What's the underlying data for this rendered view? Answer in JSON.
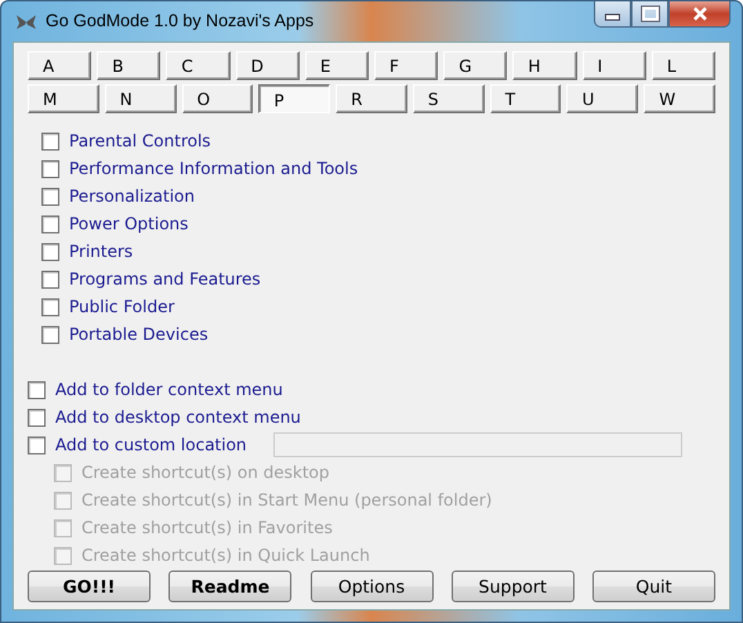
{
  "window": {
    "title": "Go GodMode 1.0 by Nozavi's Apps"
  },
  "letter_tabs": [
    [
      {
        "label": "A",
        "selected": false
      },
      {
        "label": "B",
        "selected": false
      },
      {
        "label": "C",
        "selected": false
      },
      {
        "label": "D",
        "selected": false
      },
      {
        "label": "E",
        "selected": false
      },
      {
        "label": "F",
        "selected": false
      },
      {
        "label": "G",
        "selected": false
      },
      {
        "label": "H",
        "selected": false
      },
      {
        "label": "I",
        "selected": false
      },
      {
        "label": "L",
        "selected": false
      }
    ],
    [
      {
        "label": "M",
        "selected": false
      },
      {
        "label": "N",
        "selected": false
      },
      {
        "label": "O",
        "selected": false
      },
      {
        "label": "P",
        "selected": true
      },
      {
        "label": "R",
        "selected": false
      },
      {
        "label": "S",
        "selected": false
      },
      {
        "label": "T",
        "selected": false
      },
      {
        "label": "U",
        "selected": false
      },
      {
        "label": "W",
        "selected": false
      }
    ]
  ],
  "items": [
    {
      "label": "Parental Controls",
      "checked": false
    },
    {
      "label": "Performance Information and Tools",
      "checked": false
    },
    {
      "label": "Personalization",
      "checked": false
    },
    {
      "label": "Power Options",
      "checked": false
    },
    {
      "label": "Printers",
      "checked": false
    },
    {
      "label": "Programs and Features",
      "checked": false
    },
    {
      "label": "Public Folder",
      "checked": false
    },
    {
      "label": "Portable Devices",
      "checked": false
    }
  ],
  "locations": [
    {
      "label": "Add to folder context menu",
      "checked": false,
      "has_field": false
    },
    {
      "label": "Add to desktop context menu",
      "checked": false,
      "has_field": false
    },
    {
      "label": "Add to custom location",
      "checked": false,
      "has_field": true
    }
  ],
  "shortcuts": [
    {
      "label": "Create shortcut(s) on desktop",
      "checked": false,
      "disabled": true
    },
    {
      "label": "Create shortcut(s) in Start Menu (personal folder)",
      "checked": false,
      "disabled": true
    },
    {
      "label": "Create shortcut(s) in Favorites",
      "checked": false,
      "disabled": true
    },
    {
      "label": "Create shortcut(s) in Quick Launch",
      "checked": false,
      "disabled": true
    }
  ],
  "buttons": [
    {
      "label": "GO!!!",
      "bold": true
    },
    {
      "label": "Readme",
      "bold": true
    },
    {
      "label": "Options",
      "bold": false
    },
    {
      "label": "Support",
      "bold": false
    },
    {
      "label": "Quit",
      "bold": false
    }
  ]
}
